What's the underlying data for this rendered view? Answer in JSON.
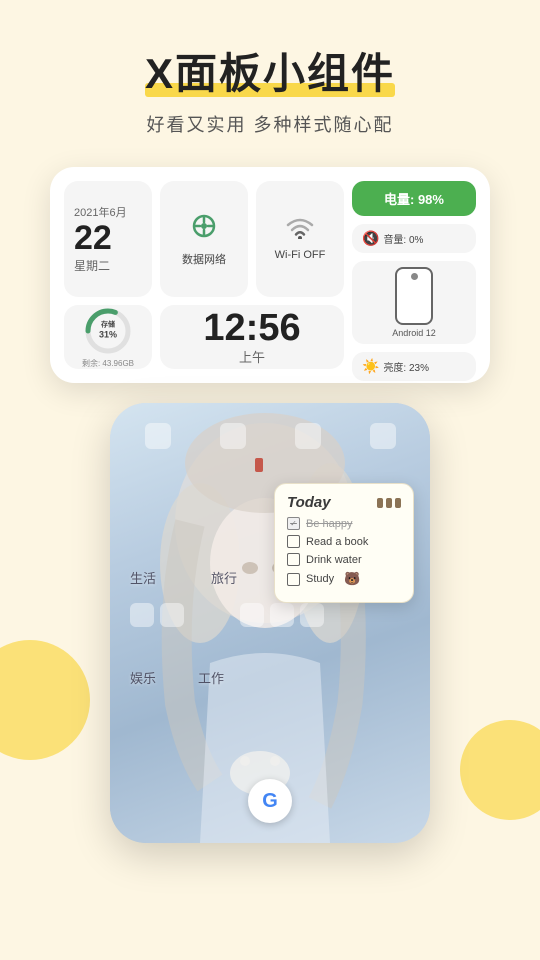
{
  "page": {
    "background_color": "#fdf6e3"
  },
  "header": {
    "title": "X面板小组件",
    "subtitle": "好看又实用  多种样式随心配",
    "title_highlight_color": "#f9d84a"
  },
  "widget_panel": {
    "date": {
      "year_month": "2021年6月",
      "day": "22",
      "weekday": "星期二"
    },
    "network": {
      "label": "数据网络"
    },
    "wifi": {
      "label": "Wi-Fi OFF"
    },
    "battery": {
      "label": "电量: 98%",
      "color": "#4caf50"
    },
    "volume": {
      "label": "音量: 0%"
    },
    "clock": {
      "time": "12:56",
      "ampm": "上午"
    },
    "storage": {
      "label": "存储",
      "percent": "31%",
      "remaining_label": "剩余: 43.96GB"
    },
    "brightness": {
      "label": "亮度: 23%"
    },
    "android": {
      "label": "Android 12"
    }
  },
  "phone_mockup": {
    "app_labels": {
      "life": "生活",
      "travel": "旅行",
      "entertainment": "娱乐",
      "work": "工作"
    },
    "google_label": "G",
    "todo": {
      "title": "Today",
      "items": [
        {
          "text": "Be happy",
          "checked": true
        },
        {
          "text": "Read a book",
          "checked": false
        },
        {
          "text": "Drink water",
          "checked": false
        },
        {
          "text": "Study",
          "checked": false
        }
      ]
    }
  }
}
